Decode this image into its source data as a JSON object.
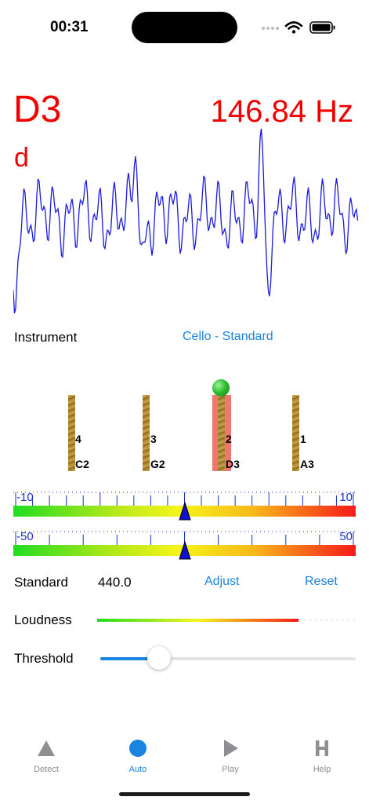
{
  "status_bar": {
    "time": "00:31"
  },
  "tuner": {
    "note": "D3",
    "frequency": "146.84",
    "frequency_unit": "Hz",
    "solfege": "d"
  },
  "instrument": {
    "label": "Instrument",
    "value": "Cello - Standard"
  },
  "strings": [
    {
      "number": "4",
      "note": "C2",
      "active": false
    },
    {
      "number": "3",
      "note": "G2",
      "active": false
    },
    {
      "number": "2",
      "note": "D3",
      "active": true
    },
    {
      "number": "1",
      "note": "A3",
      "active": false
    }
  ],
  "meters": [
    {
      "min_label": "-10",
      "max_label": "10",
      "indicator_fraction": 0.5
    },
    {
      "min_label": "-50",
      "max_label": "50",
      "indicator_fraction": 0.5
    }
  ],
  "standard": {
    "label": "Standard",
    "value": "440.0",
    "adjust_label": "Adjust",
    "reset_label": "Reset"
  },
  "loudness": {
    "label": "Loudness",
    "level_fraction": 0.78
  },
  "threshold": {
    "label": "Threshold",
    "value_fraction": 0.23
  },
  "tabs": [
    {
      "label": "Detect",
      "icon": "triangle-icon",
      "active": false
    },
    {
      "label": "Auto",
      "icon": "circle-icon",
      "active": true
    },
    {
      "label": "Play",
      "icon": "play-icon",
      "active": false
    },
    {
      "label": "Help",
      "icon": "help-h-icon",
      "active": false
    }
  ],
  "colors": {
    "note": "#f00000",
    "accent": "#1a84e0",
    "waveform": "#1a1ae0",
    "tick": "#1a33d0",
    "inactive_tab": "#8e8e93"
  }
}
